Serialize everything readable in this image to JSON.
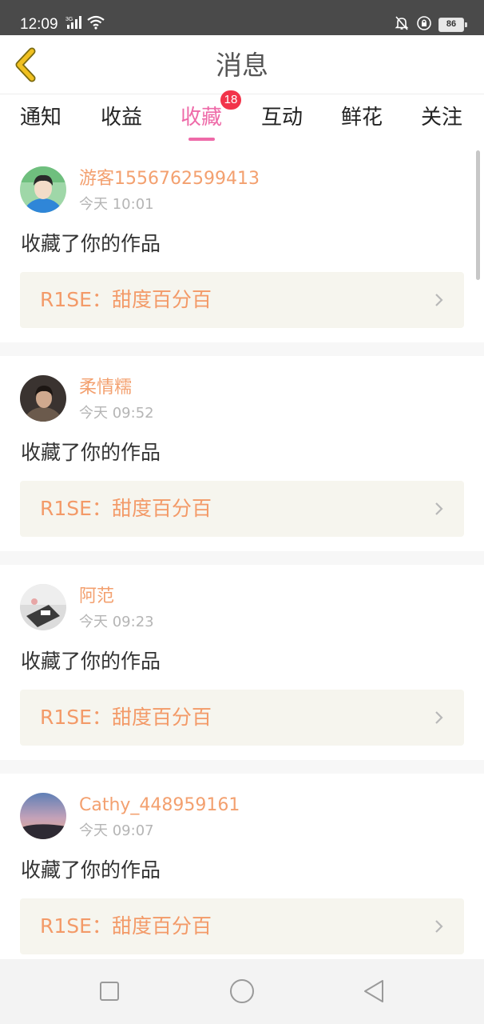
{
  "status_bar": {
    "time": "12:09",
    "network": "3G",
    "battery": "86",
    "icons": [
      "signal-icon",
      "wifi-icon",
      "mute-icon",
      "rotation-lock-icon",
      "battery-icon"
    ]
  },
  "header": {
    "title": "消息",
    "back_icon": "back-chevron-icon"
  },
  "tabs": [
    {
      "label": "通知",
      "active": false
    },
    {
      "label": "收益",
      "active": false
    },
    {
      "label": "收藏",
      "active": true,
      "badge": "18"
    },
    {
      "label": "互动",
      "active": false
    },
    {
      "label": "鲜花",
      "active": false
    },
    {
      "label": "关注",
      "active": false
    }
  ],
  "feed": [
    {
      "username": "游客1556762599413",
      "time": "今天 10:01",
      "action": "收藏了你的作品",
      "work_title": "R1SE：甜度百分百"
    },
    {
      "username": "柔情糯",
      "time": "今天 09:52",
      "action": "收藏了你的作品",
      "work_title": "R1SE：甜度百分百"
    },
    {
      "username": "阿范",
      "time": "今天 09:23",
      "action": "收藏了你的作品",
      "work_title": "R1SE：甜度百分百"
    },
    {
      "username": "Cathy_448959161",
      "time": "今天 09:07",
      "action": "收藏了你的作品",
      "work_title": "R1SE：甜度百分百"
    }
  ],
  "colors": {
    "accent": "#ee6aa8",
    "username": "#f3a06f",
    "work_title": "#f39a68",
    "badge": "#f2334a",
    "back_icon": "#f0c020"
  },
  "nav_bar": {
    "icons": [
      "recent-apps-icon",
      "home-icon",
      "back-icon"
    ]
  }
}
